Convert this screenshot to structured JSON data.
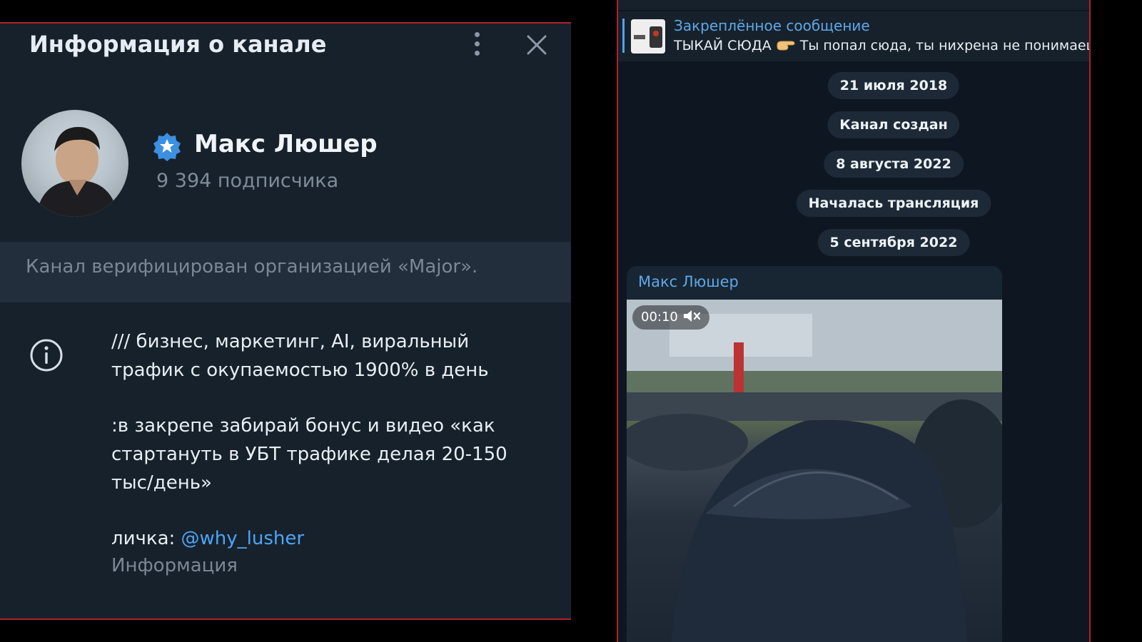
{
  "info_panel": {
    "title": "Информация о канале",
    "channel_name": "Макс Люшер",
    "subscribers": "9 394 подписчика",
    "verified_note": "Канал верифицирован организацией «Major».",
    "description": {
      "line1": "/// бизнес, маркетинг, AI, виральный",
      "line2": "трафик с окупаемостью 1900% в день",
      "line3": ":в закрепе забирай бонус и видео «как",
      "line4": "стартануть в УБТ трафике делая 20-150",
      "line5": "тыс/день»",
      "contact_label": "личка:",
      "contact_handle": "@why_lusher"
    },
    "description_caption": "Информация",
    "icons": {
      "more": "kebab-menu-icon",
      "close": "close-icon",
      "verified": "verified-badge-icon",
      "info": "info-icon"
    },
    "accent_color": "#4ea4f6",
    "border_color": "#b3202b"
  },
  "chat": {
    "pinned": {
      "title": "Закреплённое сообщение",
      "text_before": "ТЫКАЙ СЮДА",
      "text_after": "Ты попал сюда, ты нихрена не понимаешь"
    },
    "service_messages": [
      "21 июля 2018",
      "Канал создан",
      "8 августа 2022",
      "Началась трансляция",
      "5 сентября 2022"
    ],
    "message": {
      "author": "Макс Люшер",
      "video_duration": "00:10"
    }
  }
}
